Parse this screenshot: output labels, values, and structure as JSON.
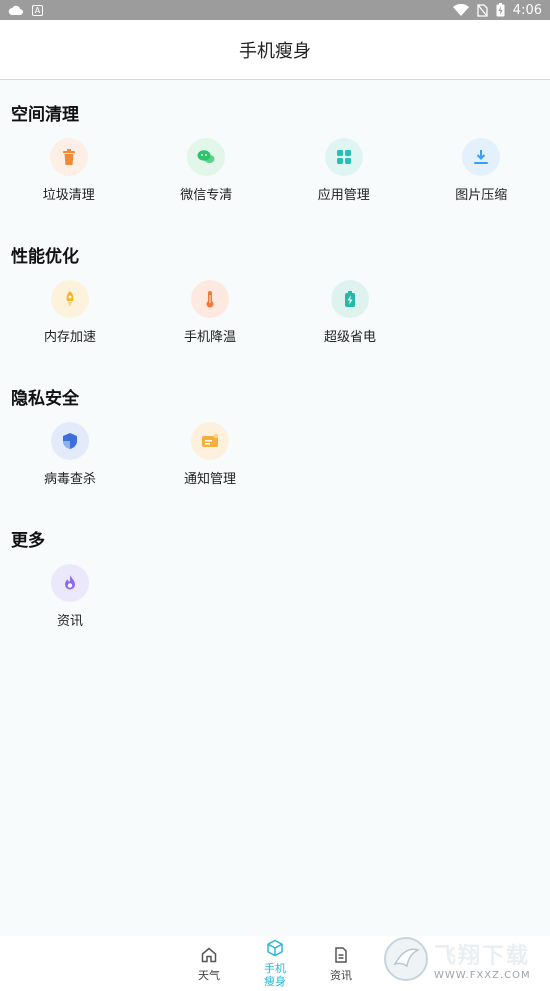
{
  "status_bar": {
    "time": "4:06",
    "box_letter": "A"
  },
  "header": {
    "title": "手机瘦身"
  },
  "sections": [
    {
      "title": "空间清理",
      "items": [
        {
          "label": "垃圾清理",
          "icon": "trash-icon",
          "color": "#f08a3b",
          "bg": "#fdeee6"
        },
        {
          "label": "微信专清",
          "icon": "wechat-icon",
          "color": "#2cc36b",
          "bg": "#e3f6ea"
        },
        {
          "label": "应用管理",
          "icon": "apps-grid-icon",
          "color": "#24c2b4",
          "bg": "#dff5f3"
        },
        {
          "label": "图片压缩",
          "icon": "compress-icon",
          "color": "#3a9ff0",
          "bg": "#e4f1fc"
        }
      ]
    },
    {
      "title": "性能优化",
      "items": [
        {
          "label": "内存加速",
          "icon": "rocket-icon",
          "color": "#f5b52b",
          "bg": "#fdf3dd"
        },
        {
          "label": "手机降温",
          "icon": "thermometer-icon",
          "color": "#f07a3b",
          "bg": "#fde9df"
        },
        {
          "label": "超级省电",
          "icon": "battery-icon",
          "color": "#25b8a6",
          "bg": "#def3f0"
        }
      ]
    },
    {
      "title": "隐私安全",
      "items": [
        {
          "label": "病毒查杀",
          "icon": "shield-icon",
          "color": "#3f6fd8",
          "bg": "#e3eafa"
        },
        {
          "label": "通知管理",
          "icon": "notification-card-icon",
          "color": "#f6ae3c",
          "bg": "#fdf1dd"
        }
      ]
    },
    {
      "title": "更多",
      "items": [
        {
          "label": "资讯",
          "icon": "flame-icon",
          "color": "#8b6cf0",
          "bg": "#ece8fb"
        }
      ]
    }
  ],
  "bottom_nav": [
    {
      "label": "天气",
      "icon": "home-icon"
    },
    {
      "label": "手机\n瘦身",
      "icon": "cube-icon",
      "active": true
    },
    {
      "label": "资讯",
      "icon": "document-icon"
    }
  ],
  "watermark": {
    "big": "飞翔下载",
    "small": "WWW.FXXZ.COM"
  }
}
